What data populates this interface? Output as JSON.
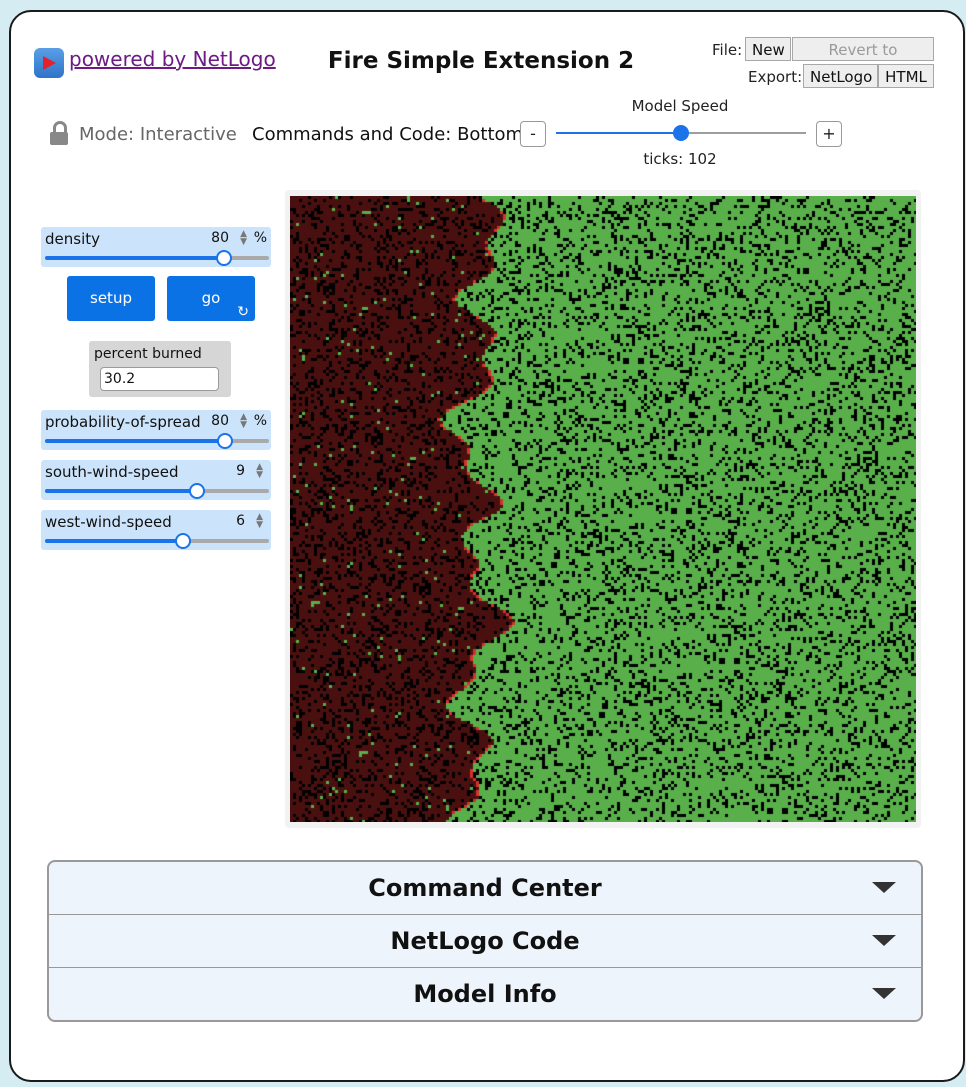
{
  "header": {
    "powered_by": "powered by NetLogo",
    "title": "Fire Simple Extension 2",
    "file_label": "File:",
    "new_label": "New",
    "revert_label": "Revert to Original",
    "export_label": "Export:",
    "export_netlogo_label": "NetLogo",
    "export_html_label": "HTML"
  },
  "toolbar": {
    "mode_label": "Mode: Interactive",
    "commands_position": "Commands and Code: Bottom",
    "speed_label": "Model Speed",
    "speed_minus": "-",
    "speed_plus": "+",
    "speed_value": 0.5,
    "ticks": "ticks: 102"
  },
  "widgets": {
    "density": {
      "name": "density",
      "value": "80",
      "unit": "%",
      "min": 0,
      "max": 99,
      "current": 80
    },
    "setup_label": "setup",
    "go_label": "go",
    "go_icon": "forever-icon",
    "percent_burned": {
      "label": "percent burned",
      "value": "30.2"
    },
    "probability_of_spread": {
      "name": "probability-of-spread",
      "value": "80",
      "unit": "%",
      "min": 0,
      "max": 100,
      "current": 80
    },
    "south_wind_speed": {
      "name": "south-wind-speed",
      "value": "9",
      "min": -25,
      "max": 25,
      "current": 9
    },
    "west_wind_speed": {
      "name": "west-wind-speed",
      "value": "6",
      "min": -25,
      "max": 25,
      "current": 6
    }
  },
  "view": {
    "colors": {
      "burned": "#4a1010",
      "tree": "#59b04a",
      "empty": "#000000",
      "fire": "#d7302a"
    }
  },
  "accordion": {
    "command_center": "Command Center",
    "netlogo_code": "NetLogo Code",
    "model_info": "Model Info"
  },
  "colors": {
    "accent": "#0b72e6",
    "widget_bg": "#cce4fb",
    "background": "#d6ecf3"
  }
}
